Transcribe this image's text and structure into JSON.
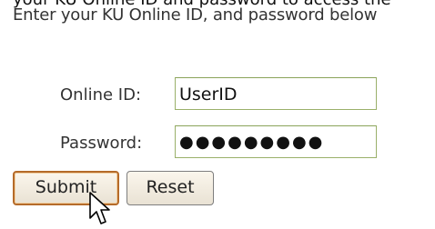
{
  "page": {
    "partial_top_line": "your KU Online ID and password to access the",
    "instructions": "Enter your KU Online ID, and password below"
  },
  "form": {
    "online_id": {
      "label": "Online ID:",
      "value": "UserID"
    },
    "password": {
      "label": "Password:",
      "value": "●●●●●●●●●"
    },
    "buttons": {
      "submit": "Submit",
      "reset": "Reset"
    }
  },
  "icons": {
    "cursor": "mouse-pointer-icon"
  },
  "colors": {
    "input_border": "#9ab06a",
    "submit_focus_border": "#b56b2a"
  }
}
